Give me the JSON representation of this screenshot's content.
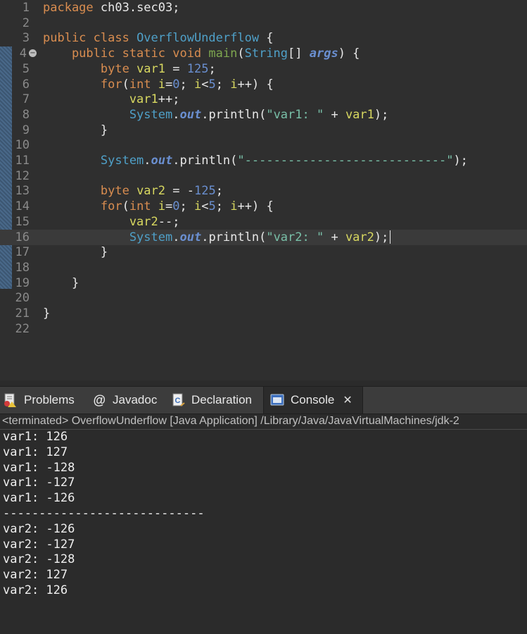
{
  "editor": {
    "lines": [
      {
        "n": "1",
        "tokens": [
          {
            "t": "package",
            "c": "kw"
          },
          {
            "t": " ch03.sec03;",
            "c": "def"
          }
        ]
      },
      {
        "n": "2",
        "tokens": []
      },
      {
        "n": "3",
        "tokens": [
          {
            "t": "public class ",
            "c": "kw"
          },
          {
            "t": "OverflowUnderflow",
            "c": "cls"
          },
          {
            "t": " {",
            "c": "def"
          }
        ]
      },
      {
        "n": "4",
        "fold": true,
        "tokens": [
          {
            "t": "    public static void ",
            "c": "kw"
          },
          {
            "t": "main",
            "c": "meth"
          },
          {
            "t": "(",
            "c": "def"
          },
          {
            "t": "String",
            "c": "cls"
          },
          {
            "t": "[] ",
            "c": "def"
          },
          {
            "t": "args",
            "c": "field"
          },
          {
            "t": ") {",
            "c": "def"
          }
        ]
      },
      {
        "n": "5",
        "tokens": [
          {
            "t": "        byte ",
            "c": "kw"
          },
          {
            "t": "var1",
            "c": "var"
          },
          {
            "t": " = ",
            "c": "def"
          },
          {
            "t": "125",
            "c": "num"
          },
          {
            "t": ";",
            "c": "def"
          }
        ]
      },
      {
        "n": "6",
        "tokens": [
          {
            "t": "        for",
            "c": "kw"
          },
          {
            "t": "(",
            "c": "def"
          },
          {
            "t": "int ",
            "c": "kw"
          },
          {
            "t": "i",
            "c": "var"
          },
          {
            "t": "=",
            "c": "def"
          },
          {
            "t": "0",
            "c": "num"
          },
          {
            "t": "; ",
            "c": "def"
          },
          {
            "t": "i",
            "c": "var"
          },
          {
            "t": "<",
            "c": "def"
          },
          {
            "t": "5",
            "c": "num"
          },
          {
            "t": "; ",
            "c": "def"
          },
          {
            "t": "i",
            "c": "var"
          },
          {
            "t": "++) {",
            "c": "def"
          }
        ]
      },
      {
        "n": "7",
        "tokens": [
          {
            "t": "            var1",
            "c": "var"
          },
          {
            "t": "++;",
            "c": "def"
          }
        ]
      },
      {
        "n": "8",
        "tokens": [
          {
            "t": "            System",
            "c": "cls"
          },
          {
            "t": ".",
            "c": "def"
          },
          {
            "t": "out",
            "c": "field"
          },
          {
            "t": ".println(",
            "c": "def"
          },
          {
            "t": "\"var1: \"",
            "c": "str"
          },
          {
            "t": " + ",
            "c": "def"
          },
          {
            "t": "var1",
            "c": "var"
          },
          {
            "t": ");",
            "c": "def"
          }
        ]
      },
      {
        "n": "9",
        "tokens": [
          {
            "t": "        }",
            "c": "def"
          }
        ]
      },
      {
        "n": "10",
        "tokens": []
      },
      {
        "n": "11",
        "tokens": [
          {
            "t": "        System",
            "c": "cls"
          },
          {
            "t": ".",
            "c": "def"
          },
          {
            "t": "out",
            "c": "field"
          },
          {
            "t": ".println(",
            "c": "def"
          },
          {
            "t": "\"----------------------------\"",
            "c": "str"
          },
          {
            "t": ");",
            "c": "def"
          }
        ]
      },
      {
        "n": "12",
        "tokens": []
      },
      {
        "n": "13",
        "tokens": [
          {
            "t": "        byte ",
            "c": "kw"
          },
          {
            "t": "var2",
            "c": "var"
          },
          {
            "t": " = -",
            "c": "def"
          },
          {
            "t": "125",
            "c": "num"
          },
          {
            "t": ";",
            "c": "def"
          }
        ]
      },
      {
        "n": "14",
        "tokens": [
          {
            "t": "        for",
            "c": "kw"
          },
          {
            "t": "(",
            "c": "def"
          },
          {
            "t": "int ",
            "c": "kw"
          },
          {
            "t": "i",
            "c": "var"
          },
          {
            "t": "=",
            "c": "def"
          },
          {
            "t": "0",
            "c": "num"
          },
          {
            "t": "; ",
            "c": "def"
          },
          {
            "t": "i",
            "c": "var"
          },
          {
            "t": "<",
            "c": "def"
          },
          {
            "t": "5",
            "c": "num"
          },
          {
            "t": "; ",
            "c": "def"
          },
          {
            "t": "i",
            "c": "var"
          },
          {
            "t": "++) {",
            "c": "def"
          }
        ]
      },
      {
        "n": "15",
        "tokens": [
          {
            "t": "            var2",
            "c": "var"
          },
          {
            "t": "--;",
            "c": "def"
          }
        ]
      },
      {
        "n": "16",
        "current": true,
        "tokens": [
          {
            "t": "            System",
            "c": "cls"
          },
          {
            "t": ".",
            "c": "def"
          },
          {
            "t": "out",
            "c": "field"
          },
          {
            "t": ".println(",
            "c": "def"
          },
          {
            "t": "\"var2: \"",
            "c": "str"
          },
          {
            "t": " + ",
            "c": "def"
          },
          {
            "t": "var2",
            "c": "var"
          },
          {
            "t": ");",
            "c": "def"
          }
        ]
      },
      {
        "n": "17",
        "tokens": [
          {
            "t": "        }",
            "c": "def"
          }
        ]
      },
      {
        "n": "18",
        "tokens": []
      },
      {
        "n": "19",
        "tokens": [
          {
            "t": "    }",
            "c": "def"
          }
        ]
      },
      {
        "n": "20",
        "tokens": []
      },
      {
        "n": "21",
        "tokens": [
          {
            "t": "}",
            "c": "def"
          }
        ]
      },
      {
        "n": "22",
        "tokens": []
      }
    ]
  },
  "panel": {
    "tabs": [
      {
        "label": "Problems",
        "icon": "problems-icon"
      },
      {
        "label": "Javadoc",
        "icon": "javadoc-icon"
      },
      {
        "label": "Declaration",
        "icon": "declaration-icon"
      },
      {
        "label": "Console",
        "icon": "console-icon",
        "active": true
      }
    ],
    "close_glyph": "✕",
    "terminated": "<terminated> OverflowUnderflow [Java Application] /Library/Java/JavaVirtualMachines/jdk-2",
    "output": [
      "var1: 126",
      "var1: 127",
      "var1: -128",
      "var1: -127",
      "var1: -126",
      "----------------------------",
      "var2: -126",
      "var2: -127",
      "var2: -128",
      "var2: 127",
      "var2: 126"
    ]
  },
  "colors": {
    "background": "#2f2f2f",
    "keyword": "#d98d50",
    "class": "#4fa0c8",
    "method": "#7ea74f",
    "string": "#79c0a8",
    "variable": "#d8d860",
    "number": "#6a8fd0"
  }
}
